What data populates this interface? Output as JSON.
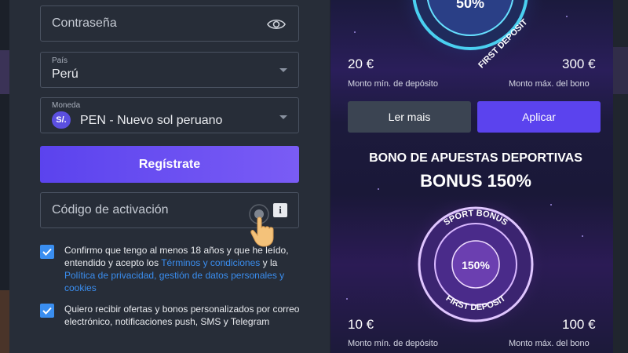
{
  "form": {
    "password_placeholder": "Contraseña",
    "country_label": "País",
    "country_value": "Perú",
    "currency_label": "Moneda",
    "currency_symbol": "S/.",
    "currency_value": "PEN - Nuevo sol peruano",
    "register_button": "Regístrate",
    "activation_placeholder": "Código de activación",
    "info_icon_glyph": "i",
    "terms": {
      "prefix": "Confirmo que tengo al menos 18 años y que he leído, entendido y acepto los ",
      "terms_link": "Términos y condiciones",
      "middle": " y la ",
      "privacy_link": "Política de privacidad, gestión de datos personales y cookies"
    },
    "offers_text": "Quiero recibir ofertas y bonos personalizados por correo electrónico, notificaciones push, SMS y Telegram"
  },
  "promo": {
    "casino": {
      "badge_percent": "50%",
      "badge_text": "FIRST DEPOSIT",
      "min_amount": "20 €",
      "min_label": "Monto mín. de depósito",
      "max_amount": "300 €",
      "max_label": "Monto máx. del bono",
      "more_button": "Ler mais",
      "apply_button": "Aplicar"
    },
    "sport": {
      "title": "BONO DE APUESTAS DEPORTIVAS",
      "bonus": "BONUS 150%",
      "badge_top_text": "SPORT BONUS",
      "badge_percent": "150%",
      "badge_bottom_text": "FIRST DEPOSIT",
      "min_amount": "10 €",
      "min_label": "Monto mín. de depósito",
      "max_amount": "100 €",
      "max_label": "Monto máx. del bono"
    }
  }
}
